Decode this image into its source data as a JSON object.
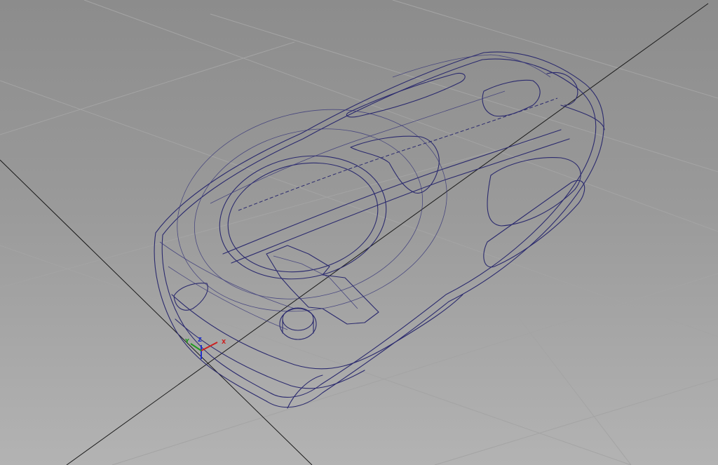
{
  "viewport": {
    "background_top": "#8c8c8c",
    "background_bottom": "#b3b3b3",
    "grid_color": "#a4a4a4",
    "wire_color": "#2b2a6e"
  },
  "model": {
    "description_icon": "wireframe-car-model-icon"
  },
  "gizmo": {
    "x_label": "X",
    "y_label": "Y",
    "z_label": "Z",
    "x_color": "#cc2020",
    "y_color": "#1f9a1f",
    "z_color": "#2030cc"
  }
}
